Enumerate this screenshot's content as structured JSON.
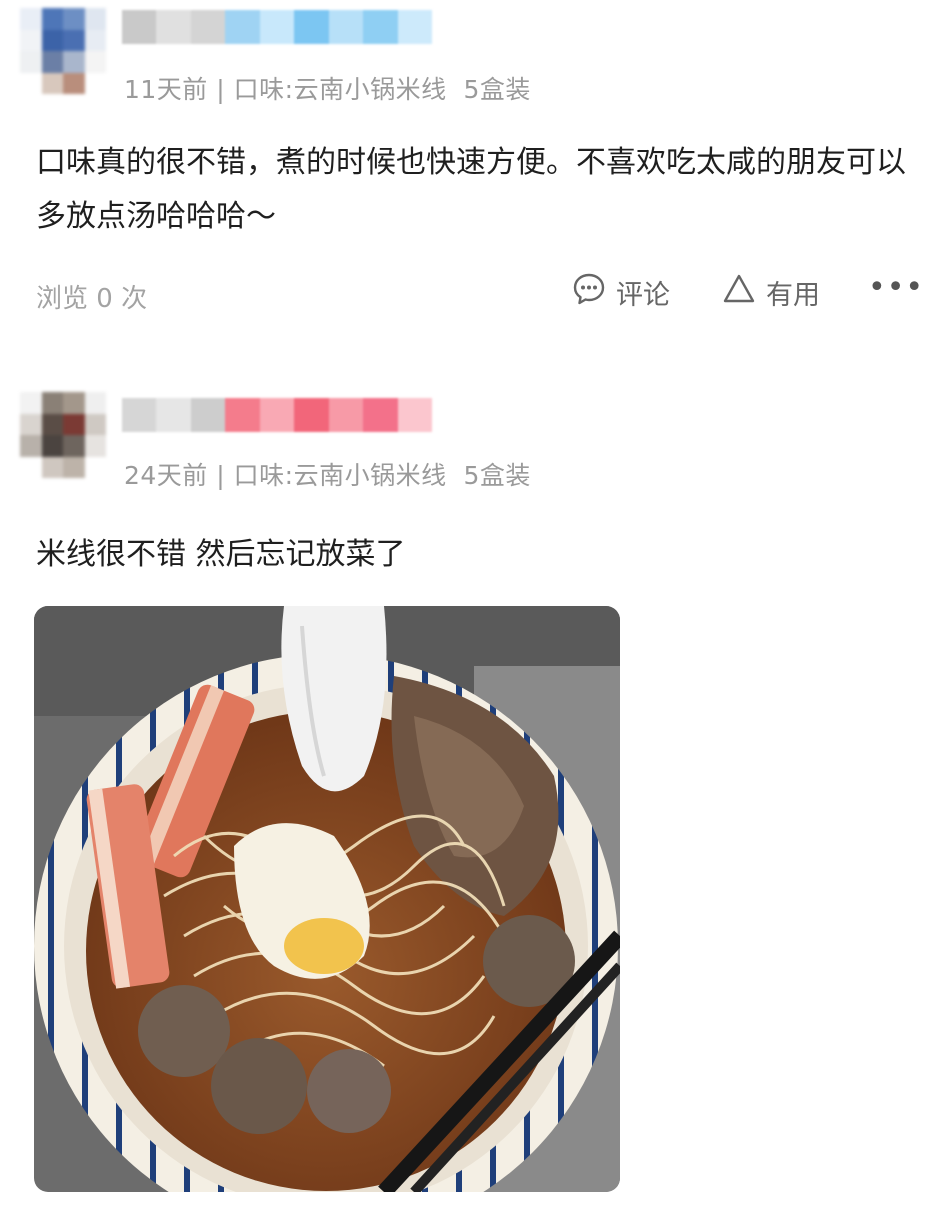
{
  "reviews": [
    {
      "time": "11天前",
      "separator": "|",
      "flavor": "口味:云南小锅米线",
      "package": "5盒装",
      "content": "口味真的很不错，煮的时候也快速方便。不喜欢吃太咸的朋友可以多放点汤哈哈哈～",
      "views": "浏览 0 次",
      "actions": {
        "comment": "评论",
        "useful": "有用",
        "more": "•••"
      }
    },
    {
      "time": "24天前",
      "separator": "|",
      "flavor": "口味:云南小锅米线",
      "package": "5盒装",
      "content": "米线很不错  然后忘记放菜了"
    }
  ],
  "icons": [
    "comment-icon",
    "thumb-useful-icon",
    "more-icon"
  ],
  "colors": {
    "meta_gray": "#9a9a9a",
    "action_gray": "#666666"
  }
}
